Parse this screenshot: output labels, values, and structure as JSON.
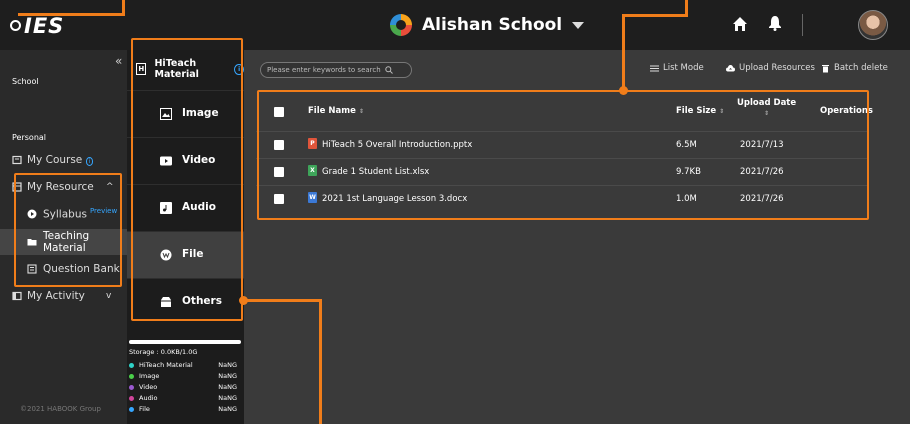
{
  "header": {
    "logo": "IES",
    "school_name": "Alishan School"
  },
  "left_sidebar": {
    "collapse": "«",
    "school_label": "School",
    "personal_label": "Personal",
    "items": [
      {
        "label": "My Course",
        "icon": "book-icon",
        "info": "i"
      },
      {
        "label": "My Resource",
        "icon": "resource-icon",
        "expand": "^"
      },
      {
        "label": "Syllabus",
        "icon": "syllabus-icon",
        "badge": "Preview"
      },
      {
        "label": "Teaching Material",
        "icon": "folder-icon"
      },
      {
        "label": "Question Bank",
        "icon": "question-bank-icon"
      },
      {
        "label": "My Activity",
        "icon": "activity-icon",
        "expand": "v"
      }
    ],
    "copyright": "©2021 HABOOK Group"
  },
  "type_panel": {
    "header": "HiTeach Material",
    "header_icon": "H",
    "types": [
      {
        "label": "Image",
        "icon": "image-icon"
      },
      {
        "label": "Video",
        "icon": "video-icon"
      },
      {
        "label": "Audio",
        "icon": "audio-icon"
      },
      {
        "label": "File",
        "icon": "file-icon"
      },
      {
        "label": "Others",
        "icon": "others-icon"
      }
    ],
    "storage": {
      "text": "Storage :  0.0KB/1.0G",
      "rows": [
        {
          "name": "HiTeach Material",
          "value": "NaNG",
          "color": "#2fd3c8"
        },
        {
          "name": "Image",
          "value": "NaNG",
          "color": "#4ad04a"
        },
        {
          "name": "Video",
          "value": "NaNG",
          "color": "#9b59d0"
        },
        {
          "name": "Audio",
          "value": "NaNG",
          "color": "#d0459b"
        },
        {
          "name": "File",
          "value": "NaNG",
          "color": "#35a6ff"
        }
      ]
    }
  },
  "main": {
    "search_placeholder": "Please enter keywords to search",
    "actions": {
      "list_mode": "List Mode",
      "upload": "Upload Resources",
      "batch_delete": "Batch delete"
    },
    "table": {
      "columns": {
        "file_name": "File Name",
        "file_size": "File Size",
        "upload_date": "Upload Date",
        "operations": "Operations",
        "sort": "⇕"
      },
      "rows": [
        {
          "name": "HiTeach 5 Overall Introduction.pptx",
          "size": "6.5M",
          "date": "2021/7/13",
          "badge": "P",
          "color": "#e0553b"
        },
        {
          "name": "Grade 1 Student List.xlsx",
          "size": "9.7KB",
          "date": "2021/7/26",
          "badge": "X",
          "color": "#3ea55a"
        },
        {
          "name": "2021 1st Language Lesson 3.docx",
          "size": "1.0M",
          "date": "2021/7/26",
          "badge": "W",
          "color": "#3b79d6"
        }
      ]
    }
  },
  "colors": {
    "accent": "#f07d1a",
    "link": "#35a6ff"
  }
}
